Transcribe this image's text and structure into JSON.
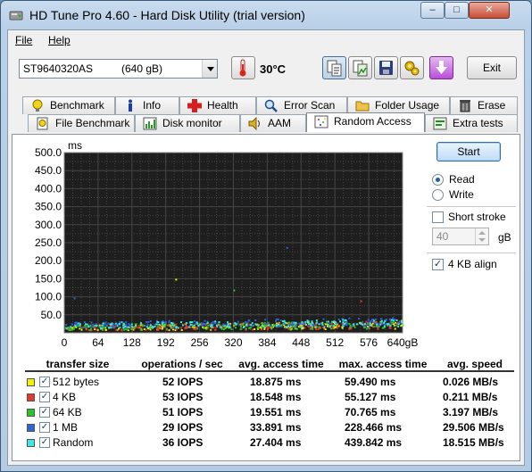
{
  "window": {
    "title": "HD Tune Pro 4.60 - Hard Disk Utility (trial version)",
    "minimize_label": "–",
    "maximize_label": "□",
    "close_label": "✕"
  },
  "menu": {
    "file": "File",
    "help": "Help"
  },
  "toolbar": {
    "drive_name": "ST9640320AS",
    "drive_capacity": "(640 gB)",
    "temperature": "30°C",
    "exit_label": "Exit"
  },
  "tabs_top": [
    "Benchmark",
    "Info",
    "Health",
    "Error Scan",
    "Folder Usage",
    "Erase"
  ],
  "tabs_bottom": [
    "File Benchmark",
    "Disk monitor",
    "AAM",
    "Random Access",
    "Extra tests"
  ],
  "controls": {
    "start_label": "Start",
    "read_label": "Read",
    "write_label": "Write",
    "mode_selected": "Read",
    "short_stroke_label": "Short stroke",
    "short_stroke_checked": false,
    "short_stroke_value": "40",
    "short_stroke_unit": "gB",
    "align_label": "4 KB align",
    "align_checked": true
  },
  "chart_data": {
    "type": "scatter",
    "ylabel": "ms",
    "y_ticks": [
      "500.0",
      "450.0",
      "400.0",
      "350.0",
      "300.0",
      "250.0",
      "200.0",
      "150.0",
      "100.0",
      "50.0"
    ],
    "x_ticks": [
      "0",
      "64",
      "128",
      "192",
      "256",
      "320",
      "384",
      "448",
      "512",
      "576",
      "640gB"
    ],
    "xlim": [
      0,
      640
    ],
    "ylim": [
      0,
      500
    ],
    "grid": true,
    "background": "#1e1e1e",
    "series": [
      {
        "name": "512 bytes",
        "color": "#f4f000",
        "range_start": [
          8,
          22
        ],
        "range_end": [
          13,
          35
        ]
      },
      {
        "name": "4 KB",
        "color": "#e23a2a",
        "range_start": [
          8,
          22
        ],
        "range_end": [
          13,
          35
        ]
      },
      {
        "name": "64 KB",
        "color": "#27c42a",
        "range_start": [
          9,
          24
        ],
        "range_end": [
          14,
          37
        ]
      },
      {
        "name": "1 MB",
        "color": "#2f63d8",
        "range_start": [
          16,
          32
        ],
        "range_end": [
          22,
          45
        ]
      },
      {
        "name": "Random",
        "color": "#3ee6e6",
        "range_start": [
          14,
          30
        ],
        "range_end": [
          20,
          40
        ]
      }
    ]
  },
  "results": {
    "headers": [
      "transfer size",
      "operations / sec",
      "avg. access time",
      "max. access time",
      "avg. speed"
    ],
    "rows": [
      {
        "name": "512 bytes",
        "color": "#f4f000",
        "checked": true,
        "ops": "52 IOPS",
        "avg": "18.875 ms",
        "max": "59.490 ms",
        "speed": "0.026 MB/s"
      },
      {
        "name": "4 KB",
        "color": "#e23a2a",
        "checked": true,
        "ops": "53 IOPS",
        "avg": "18.548 ms",
        "max": "55.127 ms",
        "speed": "0.211 MB/s"
      },
      {
        "name": "64 KB",
        "color": "#27c42a",
        "checked": true,
        "ops": "51 IOPS",
        "avg": "19.551 ms",
        "max": "70.765 ms",
        "speed": "3.197 MB/s"
      },
      {
        "name": "1 MB",
        "color": "#2f63d8",
        "checked": true,
        "ops": "29 IOPS",
        "avg": "33.891 ms",
        "max": "228.466 ms",
        "speed": "29.506 MB/s"
      },
      {
        "name": "Random",
        "color": "#3ee6e6",
        "checked": true,
        "ops": "36 IOPS",
        "avg": "27.404 ms",
        "max": "439.842 ms",
        "speed": "18.515 MB/s"
      }
    ]
  },
  "icons": {
    "app": "hard-disk-icon",
    "temperature": "thermometer-icon",
    "copy_text": "copy-text-icon",
    "copy_image": "copy-image-icon",
    "save": "save-icon",
    "options": "options-icon",
    "download": "download-icon"
  }
}
